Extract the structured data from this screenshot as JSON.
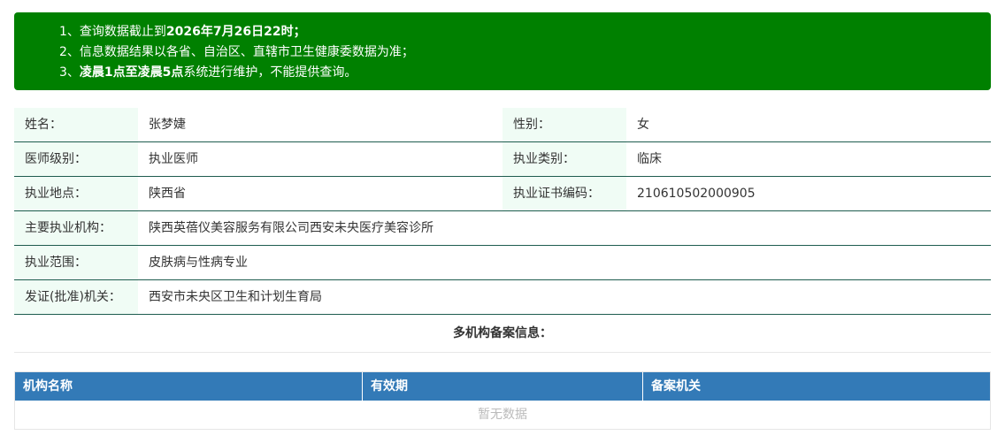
{
  "notice": {
    "line1_prefix": "1、查询数据截止到",
    "line1_emph": "2026年7月26日22时；",
    "line2": "2、信息数据结果以各省、自治区、直辖市卫生健康委数据为准；",
    "line3_prefix": "3、",
    "line3_emph": "凌晨1点至凌晨5点",
    "line3_suffix": "系统进行维护，不能提供查询。",
    "bg_color": "#008000"
  },
  "info": {
    "name_label": "姓名：",
    "name_value": "张梦婕",
    "gender_label": "性别：",
    "gender_value": "女",
    "level_label": "医师级别：",
    "level_value": "执业医师",
    "category_label": "执业类别：",
    "category_value": "临床",
    "location_label": "执业地点：",
    "location_value": "陕西省",
    "cert_label": "执业证书编码：",
    "cert_value": "210610502000905",
    "institution_label": "主要执业机构：",
    "institution_value": "陕西英蓓仪美容服务有限公司西安未央医疗美容诊所",
    "scope_label": "执业范围：",
    "scope_value": "皮肤病与性病专业",
    "issuer_label": "发证(批准)机关：",
    "issuer_value": "西安市未央区卫生和计划生育局",
    "label_bg": "#f0fcf5"
  },
  "multi": {
    "title": "多机构备案信息：",
    "columns": [
      "机构名称",
      "有效期",
      "备案机关"
    ],
    "empty_text": "暂无数据",
    "header_color": "#337ab7"
  }
}
